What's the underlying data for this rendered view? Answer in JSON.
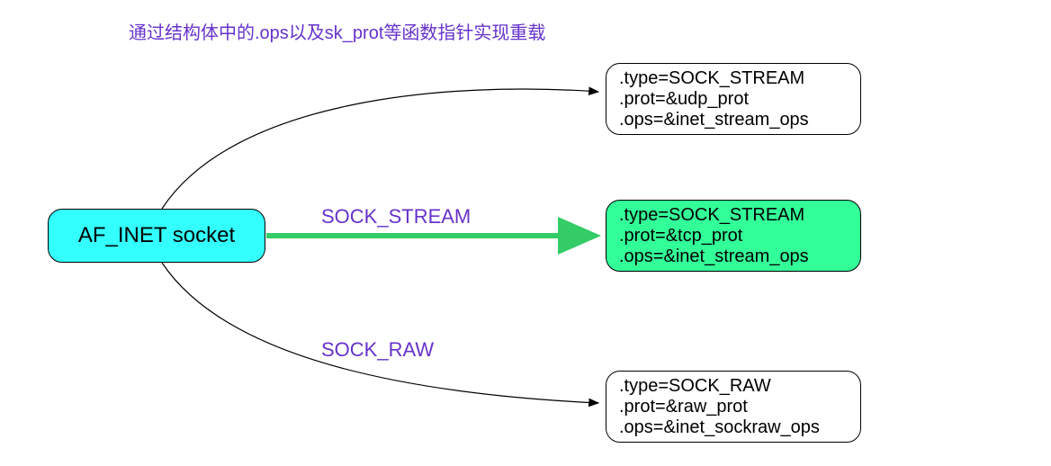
{
  "title": "通过结构体中的.ops以及sk_prot等函数指针实现重载",
  "source": {
    "label": "AF_INET socket"
  },
  "edges": {
    "middle_label": "SOCK_STREAM",
    "bottom_label": "SOCK_RAW"
  },
  "targets": [
    {
      "type": ".type=SOCK_STREAM",
      "prot": ".prot=&udp_prot",
      "ops": ".ops=&inet_stream_ops",
      "highlighted": false
    },
    {
      "type": ".type=SOCK_STREAM",
      "prot": ".prot=&tcp_prot",
      "ops": ".ops=&inet_stream_ops",
      "highlighted": true
    },
    {
      "type": ".type=SOCK_RAW",
      "prot": ".prot=&raw_prot",
      "ops": ".ops=&inet_sockraw_ops",
      "highlighted": false
    }
  ],
  "colors": {
    "title": "#6633cc",
    "source_bg": "#33ffff",
    "highlight_bg": "#33ff99",
    "arrow_main": "#33ff99",
    "arrow_thin": "#000000"
  }
}
